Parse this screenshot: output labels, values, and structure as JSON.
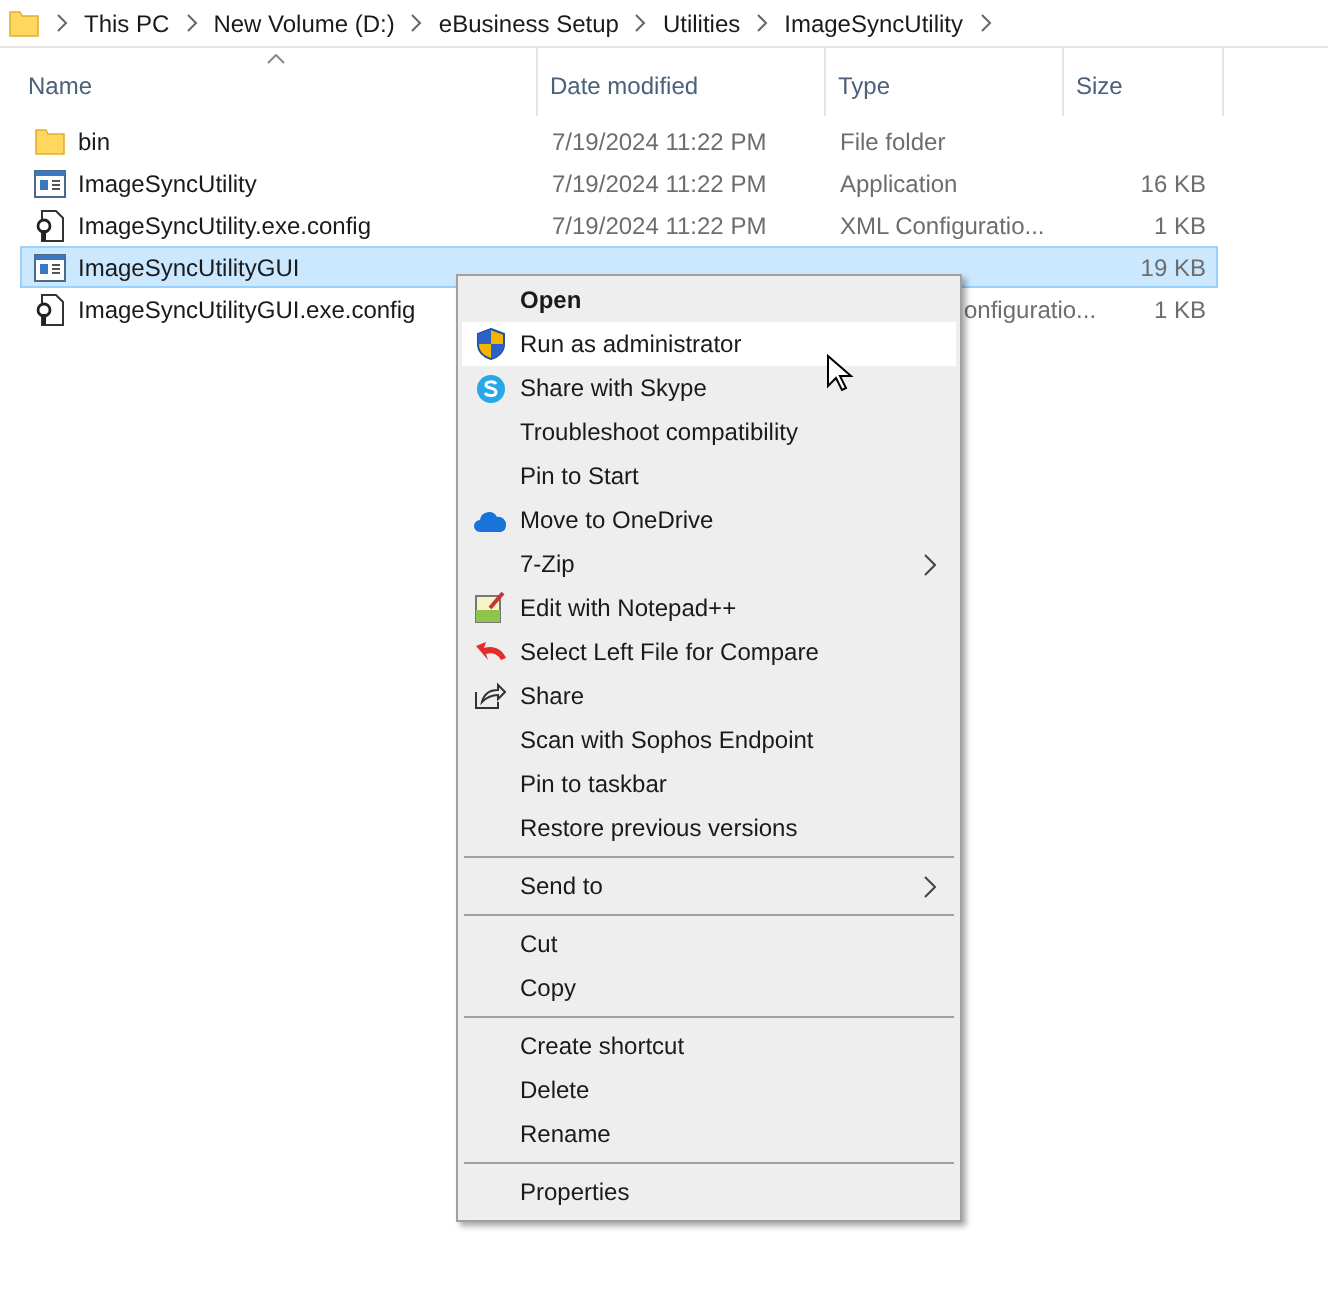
{
  "breadcrumb": [
    "This PC",
    "New Volume (D:)",
    "eBusiness Setup",
    "Utilities",
    "ImageSyncUtility"
  ],
  "columns": [
    {
      "label": "Name",
      "sorted": true
    },
    {
      "label": "Date modified",
      "sorted": false
    },
    {
      "label": "Type",
      "sorted": false
    },
    {
      "label": "Size",
      "sorted": false
    }
  ],
  "files": [
    {
      "kind": "folder",
      "name": "bin",
      "date": "7/19/2024 11:22 PM",
      "type": "File folder",
      "selected": false
    },
    {
      "kind": "app",
      "name": "ImageSyncUtility",
      "date": "7/19/2024 11:22 PM",
      "type": "Application",
      "size": "16 KB",
      "selected": false
    },
    {
      "kind": "config",
      "name": "ImageSyncUtility.exe.config",
      "date": "7/19/2024 11:22 PM",
      "type": "XML Configuratio...",
      "size": "1 KB",
      "selected": false
    },
    {
      "kind": "app",
      "name": "ImageSyncUtilityGUI",
      "size": "19 KB",
      "selected": true
    },
    {
      "kind": "config",
      "name": "ImageSyncUtilityGUI.exe.config",
      "type_visible_part": "onfiguratio...",
      "size": "1 KB",
      "selected": false
    }
  ],
  "context_menu": {
    "groups": [
      [
        {
          "label": "Open",
          "default": true,
          "selected": false,
          "submenu": false
        },
        {
          "label": "Run as administrator",
          "default": false,
          "selected": true,
          "submenu": false
        },
        {
          "label": "Share with Skype",
          "default": false,
          "selected": false,
          "submenu": false
        },
        {
          "label": "Troubleshoot compatibility",
          "default": false,
          "selected": false,
          "submenu": false
        },
        {
          "label": "Pin to Start",
          "default": false,
          "selected": false,
          "submenu": false
        },
        {
          "label": "Move to OneDrive",
          "default": false,
          "selected": false,
          "submenu": false
        },
        {
          "label": "7-Zip",
          "default": false,
          "selected": false,
          "submenu": true
        },
        {
          "label": "Edit with Notepad++",
          "default": false,
          "selected": false,
          "submenu": false
        },
        {
          "label": "Select Left File for Compare",
          "default": false,
          "selected": false,
          "submenu": false
        },
        {
          "label": "Share",
          "default": false,
          "selected": false,
          "submenu": false
        },
        {
          "label": "Scan with Sophos Endpoint",
          "default": false,
          "selected": false,
          "submenu": false
        },
        {
          "label": "Pin to taskbar",
          "default": false,
          "selected": false,
          "submenu": false
        },
        {
          "label": "Restore previous versions",
          "default": false,
          "selected": false,
          "submenu": false
        }
      ],
      [
        {
          "label": "Send to",
          "default": false,
          "selected": false,
          "submenu": true
        }
      ],
      [
        {
          "label": "Cut",
          "default": false,
          "selected": false,
          "submenu": false
        },
        {
          "label": "Copy",
          "default": false,
          "selected": false,
          "submenu": false
        }
      ],
      [
        {
          "label": "Create shortcut",
          "default": false,
          "selected": false,
          "submenu": false
        },
        {
          "label": "Delete",
          "default": false,
          "selected": false,
          "submenu": false
        },
        {
          "label": "Rename",
          "default": false,
          "selected": false,
          "submenu": false
        }
      ],
      [
        {
          "label": "Properties",
          "default": false,
          "selected": false,
          "submenu": false
        }
      ]
    ]
  }
}
